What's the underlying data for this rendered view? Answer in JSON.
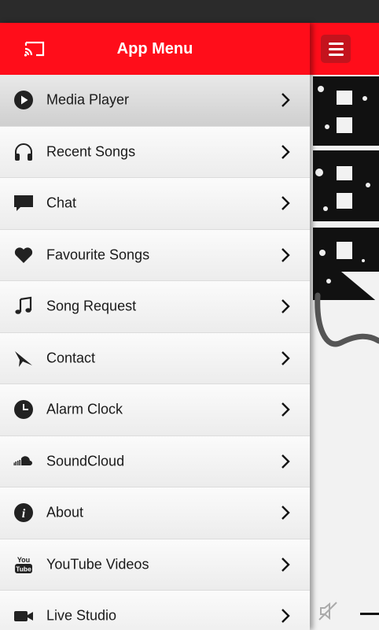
{
  "drawer": {
    "title": "App Menu",
    "items": [
      {
        "label": "Media Player",
        "icon": "play-circle-icon",
        "active": true
      },
      {
        "label": "Recent Songs",
        "icon": "headphones-icon"
      },
      {
        "label": "Chat",
        "icon": "chat-bubble-icon"
      },
      {
        "label": "Favourite Songs",
        "icon": "heart-icon"
      },
      {
        "label": "Song Request",
        "icon": "music-note-icon"
      },
      {
        "label": "Contact",
        "icon": "paper-plane-icon"
      },
      {
        "label": "Alarm Clock",
        "icon": "clock-icon"
      },
      {
        "label": "SoundCloud",
        "icon": "soundcloud-icon"
      },
      {
        "label": "About",
        "icon": "info-icon"
      },
      {
        "label": "YouTube Videos",
        "icon": "youtube-icon"
      },
      {
        "label": "Live Studio",
        "icon": "video-camera-icon"
      }
    ]
  },
  "colors": {
    "header_red": "#ff0d1a",
    "hamburger_bg": "#c4131d",
    "status_bar": "#2b2b2b"
  }
}
